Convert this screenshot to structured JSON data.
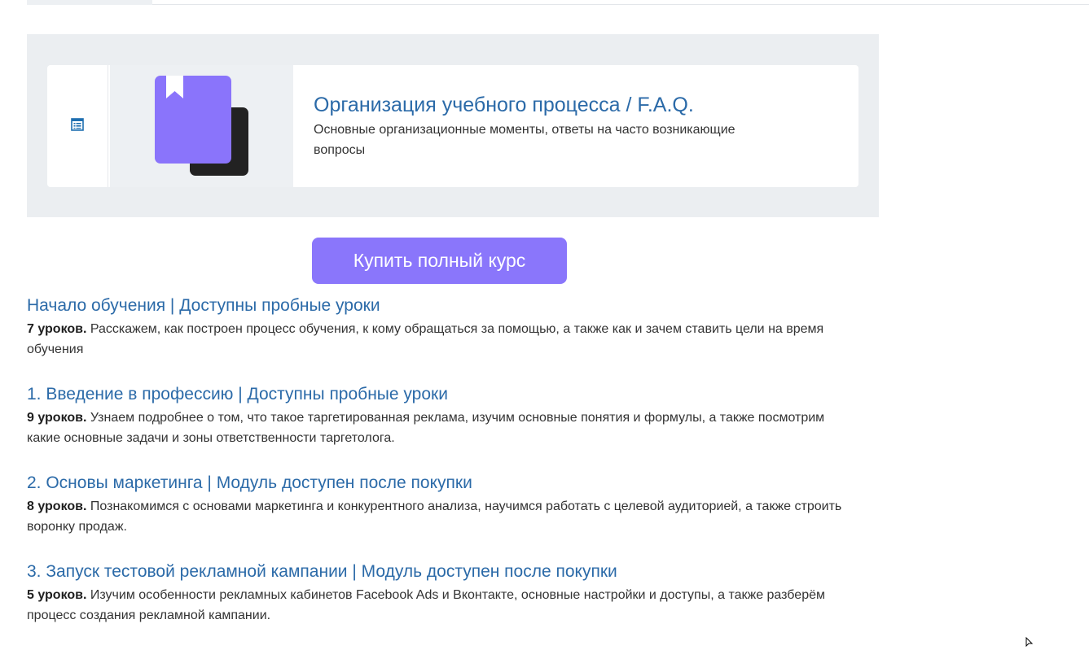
{
  "colors": {
    "link": "#2b6aa8",
    "accent": "#8a76fb",
    "panel_bg": "#ebeef1"
  },
  "featured": {
    "icon": "list-icon",
    "image": "book-bookmark-illustration",
    "title": "Организация учебного процесса / F.A.Q.",
    "description": "Основные организационные моменты, ответы на часто возникающие вопросы"
  },
  "buy_button": {
    "label": "Купить полный курс"
  },
  "modules": [
    {
      "title": "Начало обучения | Доступны пробные уроки",
      "lessons": "7 уроков.",
      "description": "Расскажем, как построен процесс обучения, к кому обращаться за помощью, а также как и зачем ставить цели на время обучения"
    },
    {
      "title": "1. Введение в профессию | Доступны пробные уроки",
      "lessons": "9 уроков.",
      "description": "Узнаем подробнее о том, что такое таргетированная реклама, изучим основные понятия и формулы, а также посмотрим какие основные задачи и зоны ответственности таргетолога."
    },
    {
      "title": "2. Основы маркетинга | Модуль доступен после покупки",
      "lessons": "8 уроков.",
      "description": "Познакомимся с основами маркетинга и конкурентного анализа, научимся работать с целевой аудиторией, а также строить воронку продаж."
    },
    {
      "title": "3. Запуск тестовой рекламной кампании | Модуль доступен после покупки",
      "lessons": "5 уроков.",
      "description": "Изучим особенности рекламных кабинетов Facebook Ads и Вконтакте, основные настройки и доступы, а также разберём процесс создания рекламной кампании."
    }
  ]
}
